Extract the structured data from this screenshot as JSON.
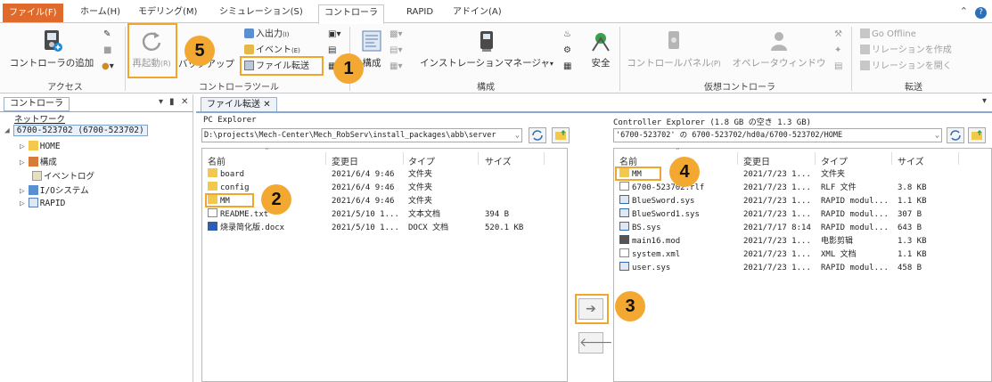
{
  "menu": {
    "tabs": [
      "ファイル(F)",
      "ホーム(H)",
      "モデリング(M)",
      "シミュレーション(S)",
      "コントローラ",
      "RAPID",
      "アドイン(A)"
    ]
  },
  "ribbon": {
    "add_controller": "コントローラの追加",
    "restart": "再起動",
    "restart_key": "(R)",
    "backup": "バックアップ",
    "io": "入出力",
    "io_key": "(I)",
    "event": "イベント",
    "event_key": "(E)",
    "file_transfer": "ファイル転送",
    "config": "構成",
    "installation_manager": "インストレーションマネージャ",
    "safety": "安全",
    "control_panel": "コントロールパネル",
    "control_panel_key": "(P)",
    "operator_window": "オペレータウィンドウ",
    "go_offline": "Go Offline",
    "create_relation": "リレーションを作成",
    "open_relation": "リレーションを開く",
    "groups": {
      "access": "アクセス",
      "controller_tools": "コントローラツール",
      "config": "構成",
      "virtual_controller": "仮想コントローラ",
      "transfer": "転送"
    }
  },
  "left_panel": {
    "tab": "コントローラ",
    "network": "ネットワーク",
    "controller": "6700-523702 (6700-523702)",
    "nodes": [
      "HOME",
      "構成",
      "イベントログ",
      "I/Oシステム",
      "RAPID"
    ]
  },
  "doc": {
    "tab": "ファイル転送",
    "pc": {
      "title": "PC Explorer",
      "path": "D:\\projects\\Mech-Center\\Mech_RobServ\\install_packages\\abb\\server",
      "columns": [
        "名前",
        "変更日",
        "タイプ",
        "サイズ"
      ],
      "rows": [
        {
          "name": "board",
          "date": "2021/6/4 9:46",
          "type": "文件夹",
          "size": "",
          "icon": "folder"
        },
        {
          "name": "config",
          "date": "2021/6/4 9:46",
          "type": "文件夹",
          "size": "",
          "icon": "folder"
        },
        {
          "name": "MM",
          "date": "2021/6/4 9:46",
          "type": "文件夹",
          "size": "",
          "icon": "folder"
        },
        {
          "name": "README.txt",
          "date": "2021/5/10 1...",
          "type": "文本文档",
          "size": "394 B",
          "icon": "doc"
        },
        {
          "name": "烧录简化版.docx",
          "date": "2021/5/10 1...",
          "type": "DOCX 文档",
          "size": "520.1 KB",
          "icon": "word"
        }
      ]
    },
    "ctrl": {
      "title": "Controller Explorer (1.8 GB の空き 1.3 GB)",
      "path": "'6700-523702' の 6700-523702/hd0a/6700-523702/HOME",
      "columns": [
        "名前",
        "変更日",
        "タイプ",
        "サイズ"
      ],
      "rows": [
        {
          "name": "MM",
          "date": "2021/7/23 1...",
          "type": "文件夹",
          "size": "",
          "icon": "folder"
        },
        {
          "name": "6700-523702.rlf",
          "date": "2021/7/23 1...",
          "type": "RLF 文件",
          "size": "3.8 KB",
          "icon": "doc"
        },
        {
          "name": "BlueSword.sys",
          "date": "2021/7/23 1...",
          "type": "RAPID modul...",
          "size": "1.1 KB",
          "icon": "rapid"
        },
        {
          "name": "BlueSword1.sys",
          "date": "2021/7/23 1...",
          "type": "RAPID modul...",
          "size": "307 B",
          "icon": "rapid"
        },
        {
          "name": "BS.sys",
          "date": "2021/7/17 8:14",
          "type": "RAPID modul...",
          "size": "643 B",
          "icon": "rapid"
        },
        {
          "name": "main16.mod",
          "date": "2021/7/23 1...",
          "type": "电影剪辑",
          "size": "1.3 KB",
          "icon": "movie"
        },
        {
          "name": "system.xml",
          "date": "2021/7/23 1...",
          "type": "XML 文档",
          "size": "1.1 KB",
          "icon": "doc"
        },
        {
          "name": "user.sys",
          "date": "2021/7/23 1...",
          "type": "RAPID modul...",
          "size": "458 B",
          "icon": "rapid"
        }
      ]
    }
  },
  "callouts": [
    "1",
    "2",
    "3",
    "4",
    "5"
  ],
  "colors": {
    "accent": "#f3a832",
    "file_tab": "#e06a2c"
  }
}
